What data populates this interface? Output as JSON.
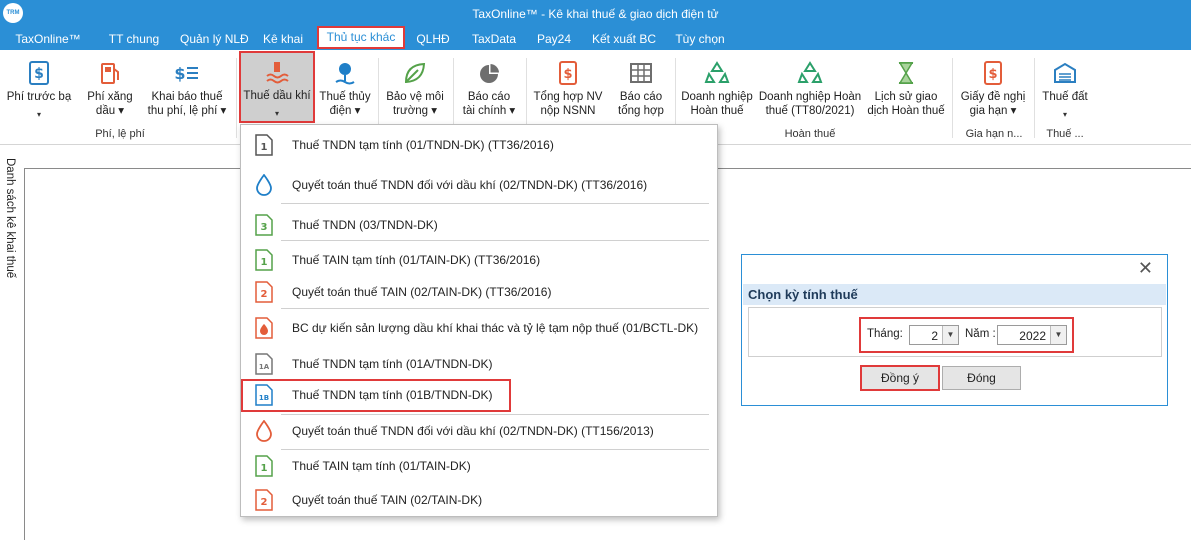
{
  "window": {
    "title": "TaxOnline™ - Kê khai thuế & giao dịch điện tử",
    "logo_text": "TRM"
  },
  "menu": {
    "items": [
      {
        "label": "TaxOnline™"
      },
      {
        "label": "TT chung"
      },
      {
        "label": "Quản lý NLĐ"
      },
      {
        "label": "Kê khai"
      },
      {
        "label": "Thủ tục khác",
        "active": true
      },
      {
        "label": "QLHĐ"
      },
      {
        "label": "TaxData"
      },
      {
        "label": "Pay24"
      },
      {
        "label": "Kết xuất BC"
      },
      {
        "label": "Tùy chọn"
      }
    ]
  },
  "ribbon": {
    "buttons": [
      {
        "line1": "Phí trước bạ",
        "line2": "▾"
      },
      {
        "line1": "Phí xăng",
        "line2": "dầu ▾"
      },
      {
        "line1": "Khai báo thuế",
        "line2": "thu phí, lệ phí ▾"
      },
      {
        "line1": "Thuế dầu khí",
        "line2": "▾"
      },
      {
        "line1": "Thuế thủy",
        "line2": "điện ▾"
      },
      {
        "line1": "Bảo vệ môi",
        "line2": "trường ▾"
      },
      {
        "line1": "Báo cáo",
        "line2": "tài chính ▾"
      },
      {
        "line1": "Tổng hợp NV",
        "line2": "nộp NSNN"
      },
      {
        "line1": "Báo cáo",
        "line2": "tổng hợp"
      },
      {
        "line1": "Doanh nghiệp",
        "line2": "Hoàn thuế"
      },
      {
        "line1": "Doanh nghiệp Hoàn",
        "line2": "thuế (TT80/2021)"
      },
      {
        "line1": "Lịch sử giao",
        "line2": "dịch Hoàn thuế"
      },
      {
        "line1": "Giấy đề nghị",
        "line2": "gia hạn ▾"
      },
      {
        "line1": "Thuế đất",
        "line2": "▾"
      }
    ],
    "groups": [
      {
        "label": "Phí, lệ phí"
      },
      {
        "label": "Hoàn thuế"
      },
      {
        "label": "Gia hạn n..."
      },
      {
        "label": "Thuế ..."
      }
    ]
  },
  "sidebar": {
    "label": "Danh sách kê khai thuế"
  },
  "dropdown": {
    "items": [
      {
        "label": "Thuế TNDN tạm tính (01/TNDN-DK) (TT36/2016)",
        "icon": "doc-1-icon"
      },
      {
        "label": "Quyết toán thuế TNDN đối với dầu khí (02/TNDN-DK) (TT36/2016)",
        "icon": "oil-drop-icon"
      },
      {
        "label": "Thuế TNDN (03/TNDN-DK)",
        "icon": "doc-3-icon"
      },
      {
        "label": "Thuế TAIN tạm tính (01/TAIN-DK) (TT36/2016)",
        "icon": "doc-1-icon"
      },
      {
        "label": "Quyết  toán thuế TAIN (02/TAIN-DK) (TT36/2016)",
        "icon": "doc-2-icon"
      },
      {
        "label": "BC dự kiến sản lượng dầu khí  khai thác và tỷ lệ tạm nộp thuế (01/BCTL-DK)",
        "icon": "doc-flame-icon"
      },
      {
        "label": "Thuế TNDN tạm tính (01A/TNDN-DK)",
        "icon": "doc-1a-icon"
      },
      {
        "label": "Thuế TNDN tạm tính (01B/TNDN-DK)",
        "icon": "doc-1b-icon",
        "highlighted": true
      },
      {
        "label": "Quyết toán thuế TNDN đối với dầu khí (02/TNDN-DK) (TT156/2013)",
        "icon": "oil-drop-icon"
      },
      {
        "label": "Thuế TAIN tạm tính (01/TAIN-DK)",
        "icon": "doc-1-icon"
      },
      {
        "label": "Quyết toán thuế TAIN (02/TAIN-DK)",
        "icon": "doc-2-icon"
      }
    ]
  },
  "dialog": {
    "title": "Chọn kỳ tính thuế",
    "close_glyph": "✕",
    "month_label": "Tháng:",
    "month_value": "2",
    "year_label": "Năm :",
    "year_value": "2022",
    "ok_label": "Đồng ý",
    "close_label": "Đóng"
  },
  "colors": {
    "accent": "#2b8fd6",
    "highlight": "#e03a3a"
  }
}
